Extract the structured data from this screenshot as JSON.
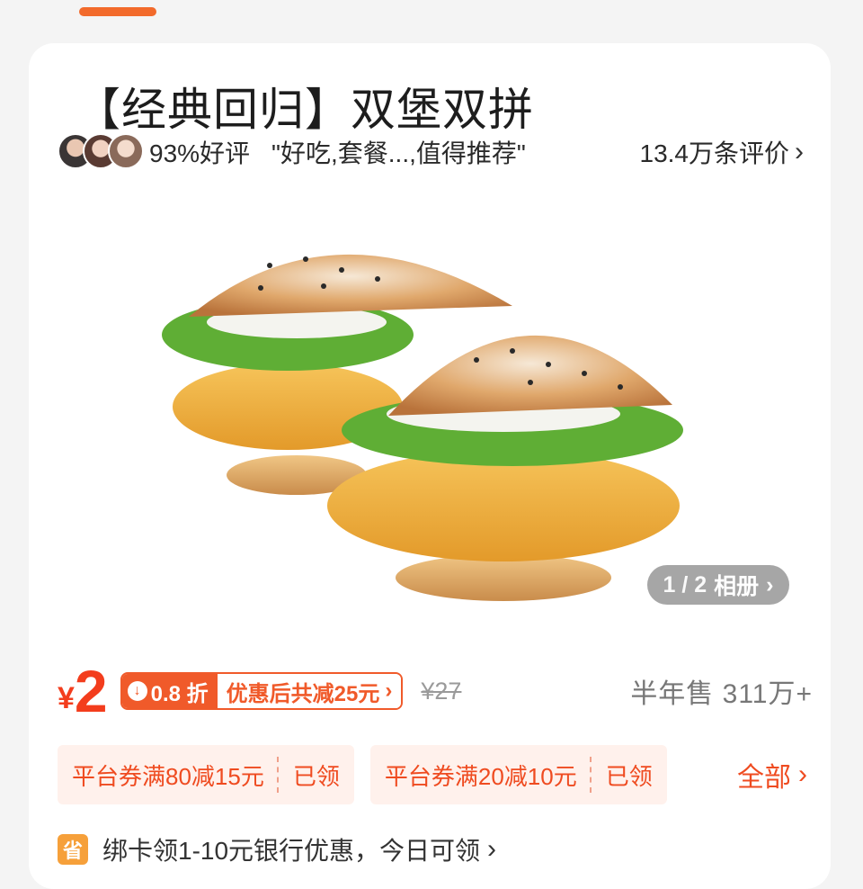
{
  "product": {
    "title": "【经典回归】双堡双拼",
    "rating_text": "93%好评",
    "review_quote": "\"好吃,套餐...,值得推荐\"",
    "review_count": "13.4万条评价",
    "chevron_glyph": "›"
  },
  "gallery": {
    "counter": "1 / 2",
    "album_label": "相册",
    "chevron_glyph": "›"
  },
  "price": {
    "currency": "¥",
    "amount": "2",
    "discount_rate": "0.8 折",
    "discount_note": "优惠后共减25元",
    "original": "¥27",
    "sales": "半年售 311万+",
    "down_glyph": "↓",
    "chevron_glyph": "›"
  },
  "coupons": [
    {
      "text": "平台券满80减15元",
      "status": "已领"
    },
    {
      "text": "平台券满20减10元",
      "status": "已领"
    }
  ],
  "coupons_all_label": "全部",
  "coupons_all_chevron": "›",
  "bank_offer": {
    "icon_glyph": "省",
    "text": "绑卡领1-10元银行优惠，今日可领",
    "chevron_glyph": "›"
  },
  "colors": {
    "accent": "#f33d1d",
    "discount": "#f05a2a",
    "coupon_bg": "#fff1ec"
  }
}
